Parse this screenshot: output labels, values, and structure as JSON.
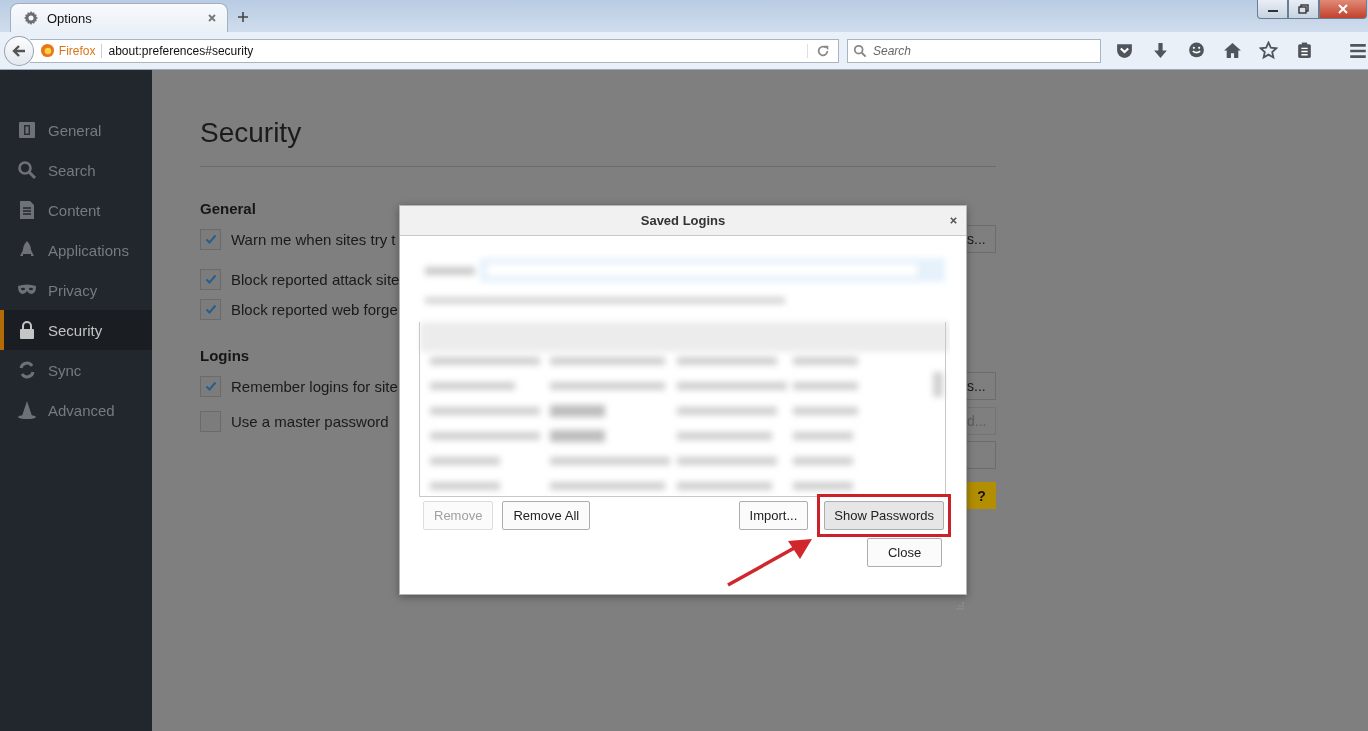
{
  "tabs": [
    {
      "title": "Options",
      "selected": true
    }
  ],
  "nav": {
    "identity": "Firefox",
    "url": "about:preferences#security",
    "search": {
      "placeholder": "Search"
    }
  },
  "sidebar": {
    "items": [
      {
        "label": "General",
        "selected": false
      },
      {
        "label": "Search",
        "selected": false
      },
      {
        "label": "Content",
        "selected": false
      },
      {
        "label": "Applications",
        "selected": false
      },
      {
        "label": "Privacy",
        "selected": false
      },
      {
        "label": "Security",
        "selected": true
      },
      {
        "label": "Sync",
        "selected": false
      },
      {
        "label": "Advanced",
        "selected": false
      }
    ]
  },
  "page": {
    "title": "Security",
    "sections": [
      {
        "heading": "General",
        "rows": [
          {
            "label": "Warn me when sites try t",
            "checked": true,
            "button": {
              "label": "s...",
              "disabled": false
            }
          },
          {
            "label": "Block reported attack site",
            "checked": true
          },
          {
            "label": "Block reported web forge",
            "checked": true
          }
        ]
      },
      {
        "heading": "Logins",
        "rows": [
          {
            "label": "Remember logins for site",
            "checked": true,
            "button": {
              "label": "s...",
              "disabled": false
            }
          },
          {
            "label": "Use a master password",
            "checked": false,
            "button": {
              "label": "d...",
              "disabled": true
            }
          }
        ]
      }
    ],
    "extra_buttons": [
      {
        "kind": "blank"
      },
      {
        "kind": "help",
        "label": "?"
      }
    ]
  },
  "dialog": {
    "title": "Saved Logins",
    "buttons": [
      {
        "label": "Remove",
        "disabled": true
      },
      {
        "label": "Remove All",
        "disabled": false
      },
      {
        "label": "Import...",
        "disabled": false
      },
      {
        "label": "Show Passwords",
        "disabled": false,
        "highlighted": true
      },
      {
        "label": "Close",
        "disabled": false
      }
    ]
  }
}
